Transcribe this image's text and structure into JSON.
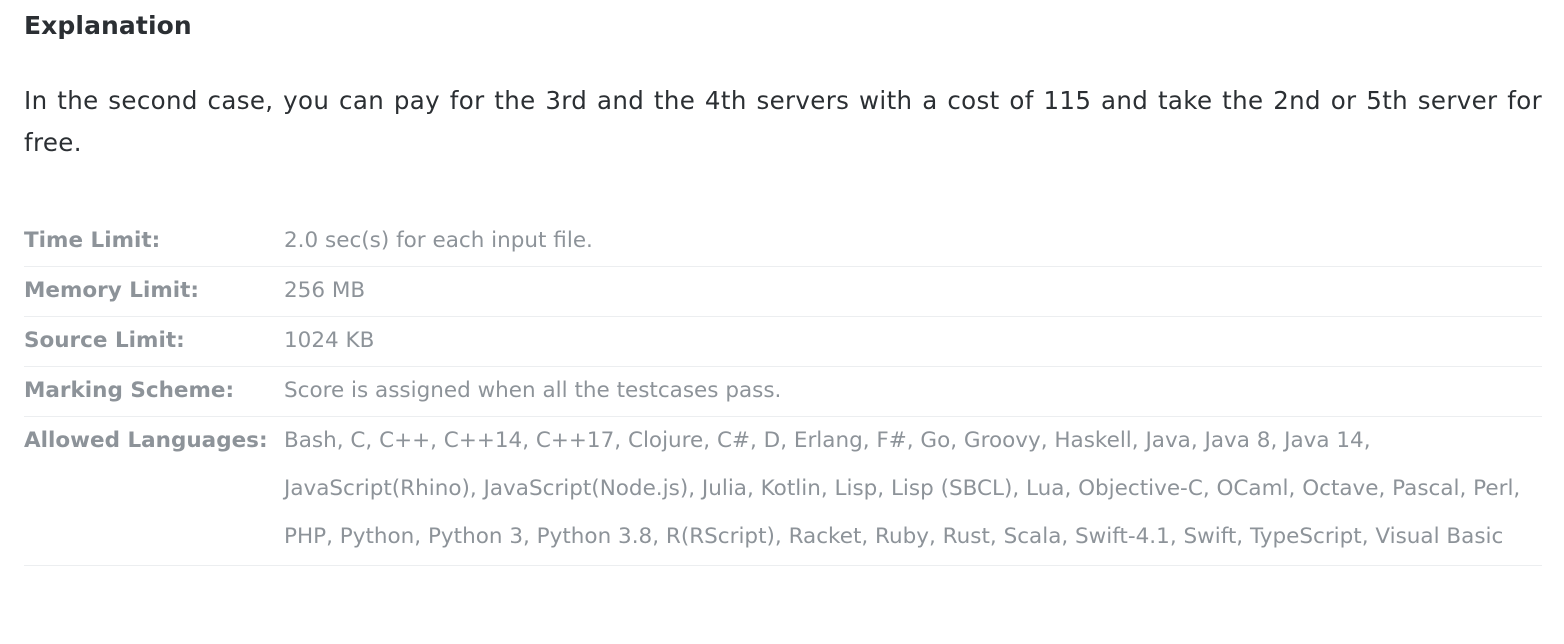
{
  "explanation": {
    "heading": "Explanation",
    "text": "In the second case, you can pay for the 3rd and the 4th servers with a cost of 115 and take the 2nd or 5th server for free."
  },
  "limits": {
    "time_limit": {
      "label": "Time Limit:",
      "value": "2.0 sec(s) for each input file."
    },
    "memory_limit": {
      "label": "Memory Limit:",
      "value": "256 MB"
    },
    "source_limit": {
      "label": "Source Limit:",
      "value": "1024 KB"
    },
    "marking_scheme": {
      "label": "Marking Scheme:",
      "value": "Score is assigned when all the testcases pass."
    },
    "allowed_languages": {
      "label": "Allowed Languages:",
      "value": "Bash, C, C++, C++14, C++17, Clojure, C#, D, Erlang, F#, Go, Groovy, Haskell, Java, Java 8, Java 14, JavaScript(Rhino), JavaScript(Node.js), Julia, Kotlin, Lisp, Lisp (SBCL), Lua, Objective-C, OCaml, Octave, Pascal, Perl, PHP, Python, Python 3, Python 3.8, R(RScript), Racket, Ruby, Rust, Scala, Swift-4.1, Swift, TypeScript, Visual Basic"
    }
  },
  "colors": {
    "heading_text": "#2b2f33",
    "muted_text": "#8d9399",
    "divider": "#eceef0"
  }
}
